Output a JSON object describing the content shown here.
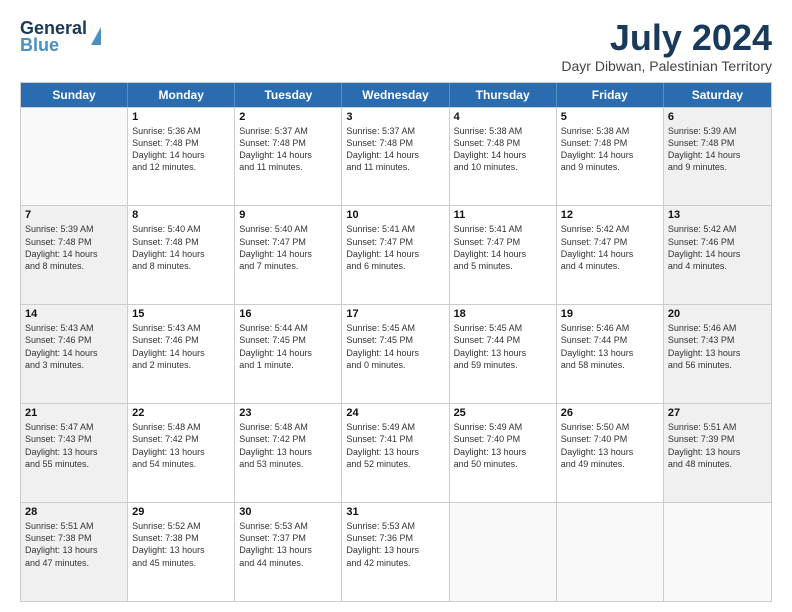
{
  "header": {
    "logo_line1": "General",
    "logo_line2": "Blue",
    "month": "July 2024",
    "location": "Dayr Dibwan, Palestinian Territory"
  },
  "days": [
    "Sunday",
    "Monday",
    "Tuesday",
    "Wednesday",
    "Thursday",
    "Friday",
    "Saturday"
  ],
  "weeks": [
    [
      {
        "day": "",
        "lines": []
      },
      {
        "day": "1",
        "lines": [
          "Sunrise: 5:36 AM",
          "Sunset: 7:48 PM",
          "Daylight: 14 hours",
          "and 12 minutes."
        ]
      },
      {
        "day": "2",
        "lines": [
          "Sunrise: 5:37 AM",
          "Sunset: 7:48 PM",
          "Daylight: 14 hours",
          "and 11 minutes."
        ]
      },
      {
        "day": "3",
        "lines": [
          "Sunrise: 5:37 AM",
          "Sunset: 7:48 PM",
          "Daylight: 14 hours",
          "and 11 minutes."
        ]
      },
      {
        "day": "4",
        "lines": [
          "Sunrise: 5:38 AM",
          "Sunset: 7:48 PM",
          "Daylight: 14 hours",
          "and 10 minutes."
        ]
      },
      {
        "day": "5",
        "lines": [
          "Sunrise: 5:38 AM",
          "Sunset: 7:48 PM",
          "Daylight: 14 hours",
          "and 9 minutes."
        ]
      },
      {
        "day": "6",
        "lines": [
          "Sunrise: 5:39 AM",
          "Sunset: 7:48 PM",
          "Daylight: 14 hours",
          "and 9 minutes."
        ]
      }
    ],
    [
      {
        "day": "7",
        "lines": [
          "Sunrise: 5:39 AM",
          "Sunset: 7:48 PM",
          "Daylight: 14 hours",
          "and 8 minutes."
        ]
      },
      {
        "day": "8",
        "lines": [
          "Sunrise: 5:40 AM",
          "Sunset: 7:48 PM",
          "Daylight: 14 hours",
          "and 8 minutes."
        ]
      },
      {
        "day": "9",
        "lines": [
          "Sunrise: 5:40 AM",
          "Sunset: 7:47 PM",
          "Daylight: 14 hours",
          "and 7 minutes."
        ]
      },
      {
        "day": "10",
        "lines": [
          "Sunrise: 5:41 AM",
          "Sunset: 7:47 PM",
          "Daylight: 14 hours",
          "and 6 minutes."
        ]
      },
      {
        "day": "11",
        "lines": [
          "Sunrise: 5:41 AM",
          "Sunset: 7:47 PM",
          "Daylight: 14 hours",
          "and 5 minutes."
        ]
      },
      {
        "day": "12",
        "lines": [
          "Sunrise: 5:42 AM",
          "Sunset: 7:47 PM",
          "Daylight: 14 hours",
          "and 4 minutes."
        ]
      },
      {
        "day": "13",
        "lines": [
          "Sunrise: 5:42 AM",
          "Sunset: 7:46 PM",
          "Daylight: 14 hours",
          "and 4 minutes."
        ]
      }
    ],
    [
      {
        "day": "14",
        "lines": [
          "Sunrise: 5:43 AM",
          "Sunset: 7:46 PM",
          "Daylight: 14 hours",
          "and 3 minutes."
        ]
      },
      {
        "day": "15",
        "lines": [
          "Sunrise: 5:43 AM",
          "Sunset: 7:46 PM",
          "Daylight: 14 hours",
          "and 2 minutes."
        ]
      },
      {
        "day": "16",
        "lines": [
          "Sunrise: 5:44 AM",
          "Sunset: 7:45 PM",
          "Daylight: 14 hours",
          "and 1 minute."
        ]
      },
      {
        "day": "17",
        "lines": [
          "Sunrise: 5:45 AM",
          "Sunset: 7:45 PM",
          "Daylight: 14 hours",
          "and 0 minutes."
        ]
      },
      {
        "day": "18",
        "lines": [
          "Sunrise: 5:45 AM",
          "Sunset: 7:44 PM",
          "Daylight: 13 hours",
          "and 59 minutes."
        ]
      },
      {
        "day": "19",
        "lines": [
          "Sunrise: 5:46 AM",
          "Sunset: 7:44 PM",
          "Daylight: 13 hours",
          "and 58 minutes."
        ]
      },
      {
        "day": "20",
        "lines": [
          "Sunrise: 5:46 AM",
          "Sunset: 7:43 PM",
          "Daylight: 13 hours",
          "and 56 minutes."
        ]
      }
    ],
    [
      {
        "day": "21",
        "lines": [
          "Sunrise: 5:47 AM",
          "Sunset: 7:43 PM",
          "Daylight: 13 hours",
          "and 55 minutes."
        ]
      },
      {
        "day": "22",
        "lines": [
          "Sunrise: 5:48 AM",
          "Sunset: 7:42 PM",
          "Daylight: 13 hours",
          "and 54 minutes."
        ]
      },
      {
        "day": "23",
        "lines": [
          "Sunrise: 5:48 AM",
          "Sunset: 7:42 PM",
          "Daylight: 13 hours",
          "and 53 minutes."
        ]
      },
      {
        "day": "24",
        "lines": [
          "Sunrise: 5:49 AM",
          "Sunset: 7:41 PM",
          "Daylight: 13 hours",
          "and 52 minutes."
        ]
      },
      {
        "day": "25",
        "lines": [
          "Sunrise: 5:49 AM",
          "Sunset: 7:40 PM",
          "Daylight: 13 hours",
          "and 50 minutes."
        ]
      },
      {
        "day": "26",
        "lines": [
          "Sunrise: 5:50 AM",
          "Sunset: 7:40 PM",
          "Daylight: 13 hours",
          "and 49 minutes."
        ]
      },
      {
        "day": "27",
        "lines": [
          "Sunrise: 5:51 AM",
          "Sunset: 7:39 PM",
          "Daylight: 13 hours",
          "and 48 minutes."
        ]
      }
    ],
    [
      {
        "day": "28",
        "lines": [
          "Sunrise: 5:51 AM",
          "Sunset: 7:38 PM",
          "Daylight: 13 hours",
          "and 47 minutes."
        ]
      },
      {
        "day": "29",
        "lines": [
          "Sunrise: 5:52 AM",
          "Sunset: 7:38 PM",
          "Daylight: 13 hours",
          "and 45 minutes."
        ]
      },
      {
        "day": "30",
        "lines": [
          "Sunrise: 5:53 AM",
          "Sunset: 7:37 PM",
          "Daylight: 13 hours",
          "and 44 minutes."
        ]
      },
      {
        "day": "31",
        "lines": [
          "Sunrise: 5:53 AM",
          "Sunset: 7:36 PM",
          "Daylight: 13 hours",
          "and 42 minutes."
        ]
      },
      {
        "day": "",
        "lines": []
      },
      {
        "day": "",
        "lines": []
      },
      {
        "day": "",
        "lines": []
      }
    ]
  ]
}
